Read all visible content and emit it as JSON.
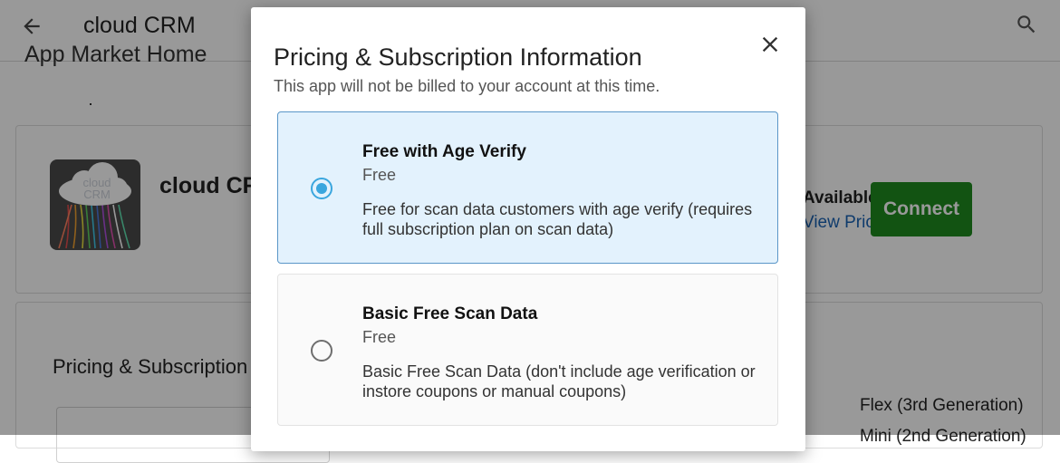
{
  "topbar": {
    "title": "cloud CRM"
  },
  "breadcrumb": {
    "label": "App Market Home"
  },
  "app_card": {
    "name": "cloud CRM",
    "logo_text": [
      "cloud",
      "CRM"
    ],
    "availability": "Available",
    "pricing_link": "View Pricing",
    "connect_label": "Connect"
  },
  "pricing_card": {
    "title": "Pricing & Subscription",
    "hardware": [
      "Flex (3rd Generation)",
      "Mini (2nd Generation)"
    ]
  },
  "modal": {
    "title": "Pricing & Subscription Information",
    "subtitle": "This app will not be billed to your account at this time.",
    "options": [
      {
        "name": "Free with Age Verify",
        "price": "Free",
        "description": "Free for scan data customers with age verify (requires full subscription plan on scan data)",
        "selected": true
      },
      {
        "name": "Basic Free Scan Data",
        "price": "Free",
        "description": "Basic Free Scan Data (don't include age verification or instore coupons or manual coupons)",
        "selected": false
      }
    ]
  },
  "colors": {
    "accent": "#3aa6de",
    "selected_bg": "#e3f2fd",
    "connect_green": "#1f8a1f",
    "link_blue": "#1a63b5"
  },
  "icons": [
    "back-arrow-icon",
    "search-icon",
    "close-icon",
    "radio-selected-icon",
    "radio-unselected-icon"
  ]
}
